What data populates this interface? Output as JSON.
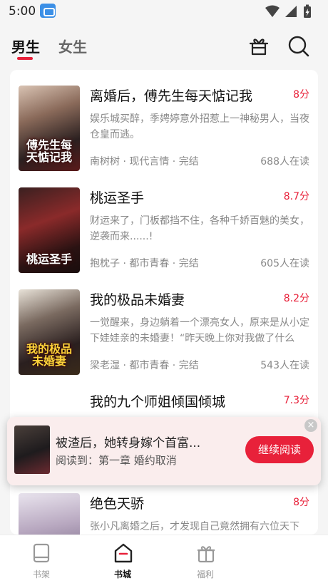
{
  "status_bar": {
    "time": "5:00"
  },
  "header": {
    "tabs": [
      {
        "label": "男生",
        "active": true
      },
      {
        "label": "女生",
        "active": false
      }
    ],
    "icons": [
      "gift-box-icon",
      "search-icon"
    ]
  },
  "colors": {
    "accent": "#e8213a",
    "background": "#f5f5f5"
  },
  "books": [
    {
      "title": "离婚后，傅先生每天惦记我",
      "score": "8分",
      "description": "娱乐城买醉，季娉婷意外招惹上一神秘男人，当夜仓皇而逃。",
      "author": "南树树",
      "category": "现代言情",
      "status": "完结",
      "readers": "688人在读",
      "cover_text": "傅先生每天惦记我"
    },
    {
      "title": "桃运圣手",
      "score": "8.7分",
      "description": "财运来了，门板都挡不住，各种千娇百魅的美女，逆袭而来......!",
      "author": "抱枕子",
      "category": "都市青春",
      "status": "完结",
      "readers": "605人在读",
      "cover_text": "桃运圣手"
    },
    {
      "title": "我的极品未婚妻",
      "score": "8.2分",
      "description": "一觉醒来，身边躺着一个漂亮女人，原来是从小定下娃娃亲的未婚妻！“昨天晚上你对我做了什么",
      "author": "梁老湿",
      "category": "都市青春",
      "status": "完结",
      "readers": "543人在读",
      "cover_text": "我的极品未婚妻"
    },
    {
      "title": "我的九个师姐倾国倾城",
      "score": "7.3分"
    },
    {
      "title": "绝色天骄",
      "score": "8分",
      "description": "张小凡离婚之后，才发现自己竟然拥有六位天下"
    }
  ],
  "continue_reading": {
    "title": "被渣后，她转身嫁个首富...",
    "progress_label": "阅读到：",
    "chapter": "第一章 婚约取消",
    "button": "继续阅读",
    "close_glyph": "×"
  },
  "bottom_nav": [
    {
      "label": "书架",
      "icon": "bookshelf-icon",
      "active": false
    },
    {
      "label": "书城",
      "icon": "bookstore-icon",
      "active": true
    },
    {
      "label": "福利",
      "icon": "gift-icon",
      "active": false
    }
  ]
}
